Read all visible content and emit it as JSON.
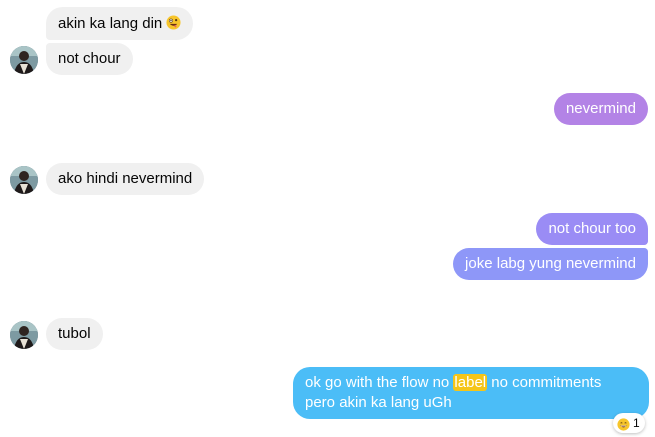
{
  "messages": [
    {
      "text": "akin ka lang din",
      "emoji": "zany-face-emoji"
    },
    {
      "text": "not chour"
    },
    {
      "text": "nevermind"
    },
    {
      "text": "ako hindi nevermind"
    },
    {
      "text": "not chour too"
    },
    {
      "text": "joke labg yung nevermind"
    },
    {
      "text": "tubol"
    },
    {
      "line1_before": "ok go with the flow no ",
      "line1_highlight": "label",
      "line1_after": " no commitments",
      "line2": "pero akin ka lang uGh",
      "reaction": {
        "emoji": "grinning-face-emoji",
        "count": "1"
      }
    }
  ],
  "colors": {
    "incoming_bubble": "#f0f0f0",
    "outgoing_purple": "#b383e6",
    "outgoing_violet": "#9a8cf5",
    "outgoing_indigo": "#8e97f8",
    "outgoing_blue": "#4bbdf7",
    "highlight": "#f5c518"
  }
}
